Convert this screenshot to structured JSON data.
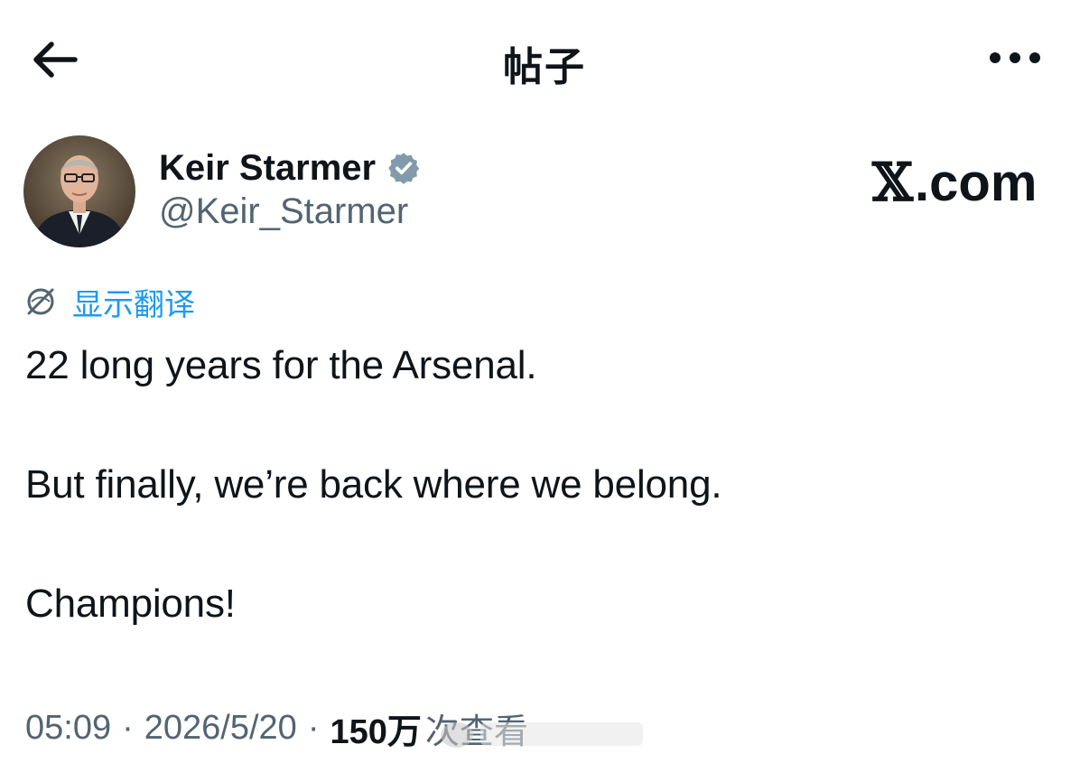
{
  "header": {
    "title": "帖子",
    "back_icon": "arrow-left-icon",
    "more_icon": "more-horizontal-icon"
  },
  "author": {
    "name": "Keir Starmer",
    "handle": "@Keir_Starmer",
    "verified_badge_color": "#829aab",
    "avatar": "avatar-photo"
  },
  "watermark": {
    "x_glyph": "𝕏",
    "text": ".com"
  },
  "translate": {
    "label": "显示翻译",
    "icon": "translate-globe-icon",
    "color": "#1d9bf0"
  },
  "tweet": {
    "paragraphs": [
      "22 long years for the Arsenal.",
      "But finally, we’re back where we belong.",
      "Champions!"
    ]
  },
  "meta": {
    "time": "05:09",
    "separator": "·",
    "date": "2026/5/20",
    "views_count": "150万",
    "views_label": "次查看"
  },
  "colors": {
    "text_primary": "#0f1419",
    "text_secondary": "#536471",
    "accent": "#1d9bf0"
  }
}
